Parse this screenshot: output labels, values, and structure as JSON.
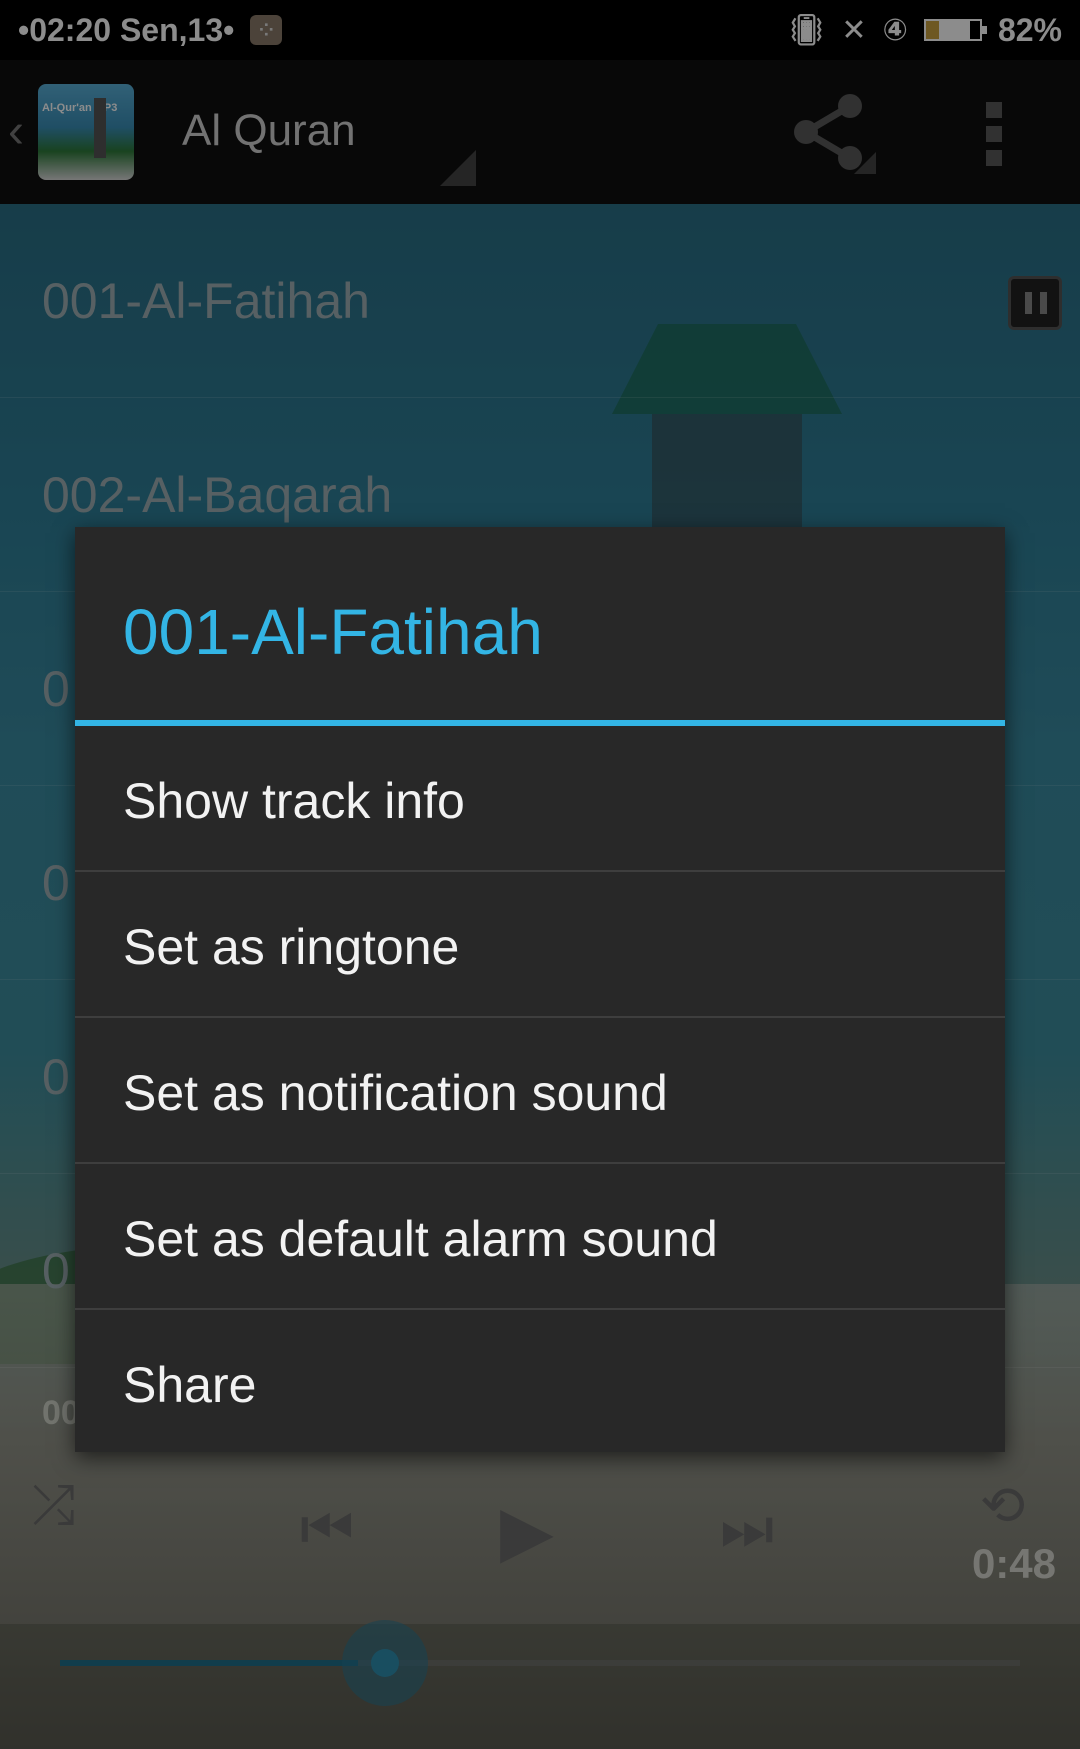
{
  "status_bar": {
    "time": "•02:20 Sen,13•",
    "battery": "82%",
    "battery_level": 0.82,
    "icons": [
      "blackberry-icon",
      "vibrate-icon",
      "no-signal-icon",
      "4g-icon",
      "battery-icon"
    ]
  },
  "action_bar": {
    "title": "Al Quran",
    "app_icon_text": "Al-Qur'an MP3",
    "icons": [
      "back-chevron-icon",
      "app-icon",
      "share-icon",
      "overflow-menu-icon"
    ]
  },
  "track_list": {
    "items": [
      {
        "label": "001-Al-Fatihah"
      },
      {
        "label": "002-Al-Baqarah"
      },
      {
        "label": "0"
      },
      {
        "label": "0"
      },
      {
        "label": "0"
      },
      {
        "label": "0"
      }
    ]
  },
  "player": {
    "now_playing": "00",
    "total_time": "0:48",
    "progress": 0.31,
    "icons": [
      "shuffle-icon",
      "previous-icon",
      "play-icon",
      "next-icon",
      "repeat-icon"
    ]
  },
  "dialog": {
    "title": "001-Al-Fatihah",
    "accent_color": "#33b5e5",
    "items": [
      {
        "label": "Show track info"
      },
      {
        "label": "Set as ringtone"
      },
      {
        "label": "Set as notification sound"
      },
      {
        "label": "Set as default alarm sound"
      },
      {
        "label": "Share"
      }
    ]
  }
}
